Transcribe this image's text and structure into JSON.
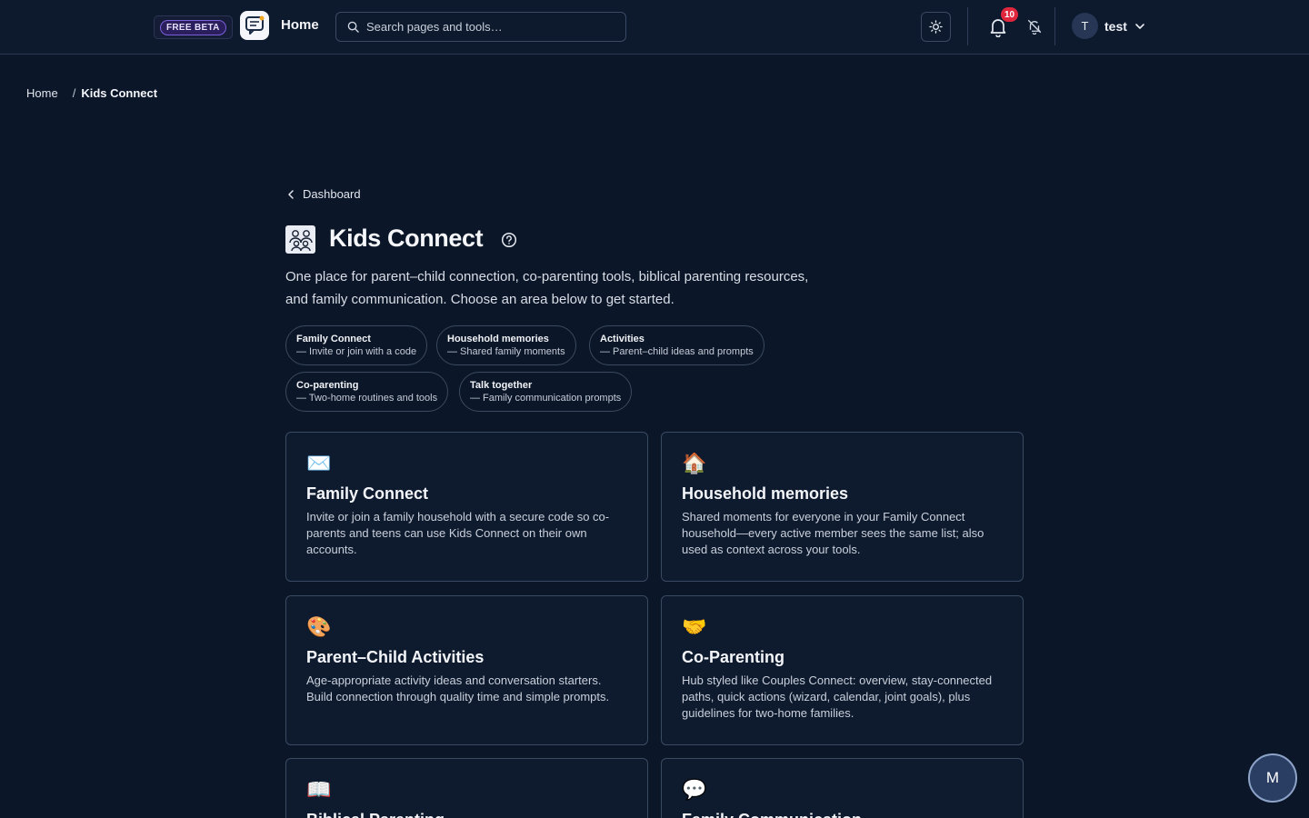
{
  "header": {
    "beta_label": "FREE BETA",
    "home_label": "Home",
    "search_placeholder": "Search pages and tools…",
    "notification_count": "10",
    "user_initial": "T",
    "user_name": "test"
  },
  "breadcrumb": {
    "home": "Home",
    "separator": "/",
    "current": "Kids Connect"
  },
  "back_label": "Dashboard",
  "page": {
    "title": "Kids Connect",
    "description_line1": "One place for parent–child connection, co-parenting tools, biblical parenting resources,",
    "description_line2": "and family communication. Choose an area below to get started."
  },
  "chips": [
    {
      "title": "Family Connect",
      "sub": "— Invite or join with a code"
    },
    {
      "title": "Household memories",
      "sub": "— Shared family moments"
    },
    {
      "title": "Activities",
      "sub": "— Parent–child ideas and prompts"
    },
    {
      "title": "Co-parenting",
      "sub": "— Two-home routines and tools"
    },
    {
      "title": "Talk together",
      "sub": "— Family communication prompts"
    }
  ],
  "cards": [
    {
      "icon": "envelope-icon",
      "emoji": "✉️",
      "title": "Family Connect",
      "text": "Invite or join a family household with a secure code so co-parents and teens can use Kids Connect on their own accounts."
    },
    {
      "icon": "house-icon",
      "emoji": "🏠",
      "title": "Household memories",
      "text": "Shared moments for everyone in your Family Connect household—every active member sees the same list; also used as context across your tools."
    },
    {
      "icon": "palette-icon",
      "emoji": "🎨",
      "title": "Parent–Child Activities",
      "text": "Age-appropriate activity ideas and conversation starters. Build connection through quality time and simple prompts."
    },
    {
      "icon": "handshake-icon",
      "emoji": "🤝",
      "title": "Co-Parenting",
      "text": "Hub styled like Couples Connect: overview, stay-connected paths, quick actions (wizard, calendar, joint goals), plus guidelines for two-home families."
    },
    {
      "icon": "book-icon",
      "emoji": "📖",
      "title": "Biblical Parenting",
      "text": ""
    },
    {
      "icon": "speech-bubble-icon",
      "emoji": "💬",
      "title": "Family Communication",
      "text": ""
    }
  ],
  "fab_label": "M",
  "colors": {
    "background": "#0b1628",
    "beta_accent": "#7b5fd9",
    "notification_badge": "#e0263d"
  }
}
